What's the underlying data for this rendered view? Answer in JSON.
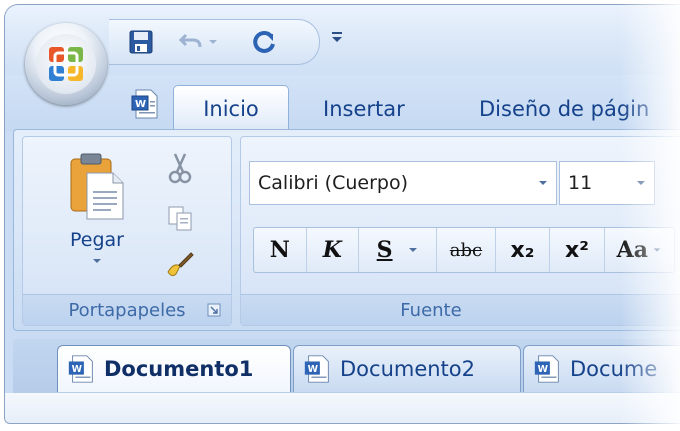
{
  "quick_access": {
    "icons": [
      "save-icon",
      "undo-icon",
      "dropdown-icon",
      "redo-icon",
      "customize-icon"
    ]
  },
  "office_button": {
    "icon": "office-logo-icon"
  },
  "ribbon_tabs": [
    {
      "label": "Inicio",
      "active": true
    },
    {
      "label": "Insertar",
      "active": false
    },
    {
      "label": "Diseño de págin",
      "active": false
    }
  ],
  "groups": {
    "clipboard": {
      "label": "Portapapeles",
      "paste_label": "Pegar",
      "icons": [
        "paste-icon",
        "cut-icon",
        "copy-icon",
        "format-painter-icon",
        "dialog-launcher-icon"
      ]
    },
    "font": {
      "label": "Fuente",
      "font_name": "Calibri (Cuerpo)",
      "font_size": "11",
      "buttons": [
        {
          "name": "bold",
          "glyph": "N"
        },
        {
          "name": "italic",
          "glyph": "K"
        },
        {
          "name": "underline",
          "glyph": "S"
        },
        {
          "name": "strikethrough",
          "glyph": "abc"
        },
        {
          "name": "subscript",
          "glyph": "x₂"
        },
        {
          "name": "superscript",
          "glyph": "x²"
        },
        {
          "name": "change-case",
          "glyph": "Aa"
        }
      ]
    }
  },
  "document_tabs": [
    {
      "label": "Documento1",
      "active": true
    },
    {
      "label": "Documento2",
      "active": false
    },
    {
      "label": "Docume",
      "active": false
    }
  ],
  "colors": {
    "accent": "#15428b",
    "ribbon": "#d8e6f7",
    "border": "#8fb1da"
  }
}
